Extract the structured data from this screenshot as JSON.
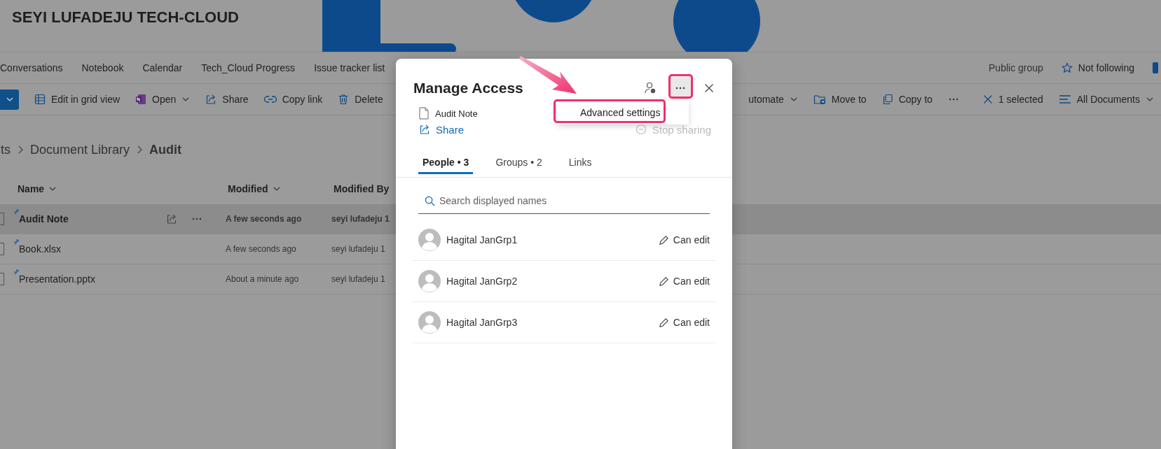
{
  "site": {
    "title": "SEYI LUFADEJU TECH-CLOUD"
  },
  "nav": {
    "items": [
      {
        "label": "Conversations"
      },
      {
        "label": "Notebook"
      },
      {
        "label": "Calendar"
      },
      {
        "label": "Tech_Cloud Progress"
      },
      {
        "label": "Issue tracker list"
      }
    ],
    "privacy": "Public group",
    "follow": {
      "label": "Not following",
      "following": false
    }
  },
  "command_bar": {
    "left": [
      {
        "label": "Edit in grid view",
        "dropdown": false
      },
      {
        "label": "Open",
        "dropdown": true
      },
      {
        "label": "Share",
        "dropdown": false
      },
      {
        "label": "Copy link",
        "dropdown": false
      },
      {
        "label": "Delete",
        "dropdown": false
      }
    ],
    "right": [
      {
        "label": "utomate",
        "dropdown": true
      },
      {
        "label": "Move to",
        "dropdown": false
      },
      {
        "label": "Copy to",
        "dropdown": false
      }
    ],
    "selection": "1 selected",
    "view": {
      "label": "All Documents",
      "dropdown": true
    }
  },
  "breadcrumb": [
    {
      "label": "ts",
      "current": false
    },
    {
      "label": "Document Library",
      "current": false
    },
    {
      "label": "Audit",
      "current": true
    }
  ],
  "library": {
    "columns": [
      "Name",
      "Modified",
      "Modified By"
    ],
    "rows": [
      {
        "name": "Audit Note",
        "modified": "A few seconds ago",
        "modified_by": "seyi lufadeju 1",
        "selected": true
      },
      {
        "name": "Book.xlsx",
        "modified": "A few seconds ago",
        "modified_by": "seyi lufadeju 1",
        "selected": false
      },
      {
        "name": "Presentation.pptx",
        "modified": "About a minute ago",
        "modified_by": "seyi lufadeju 1",
        "selected": false
      }
    ]
  },
  "dialog": {
    "title": "Manage Access",
    "file": "Audit Note",
    "share": "Share",
    "stop_sharing": {
      "label": "Stop sharing",
      "disabled": true
    },
    "tabs": [
      {
        "label": "People • 3",
        "selected": true
      },
      {
        "label": "Groups • 2",
        "selected": false
      },
      {
        "label": "Links",
        "selected": false
      }
    ],
    "search": {
      "placeholder": "Search displayed names"
    },
    "people": [
      {
        "name": "Hagital JanGrp1",
        "permission": "Can edit"
      },
      {
        "name": "Hagital JanGrp2",
        "permission": "Can edit"
      },
      {
        "name": "Hagital JanGrp3",
        "permission": "Can edit"
      }
    ],
    "menu": {
      "items": [
        {
          "label": "Advanced settings"
        }
      ]
    }
  }
}
